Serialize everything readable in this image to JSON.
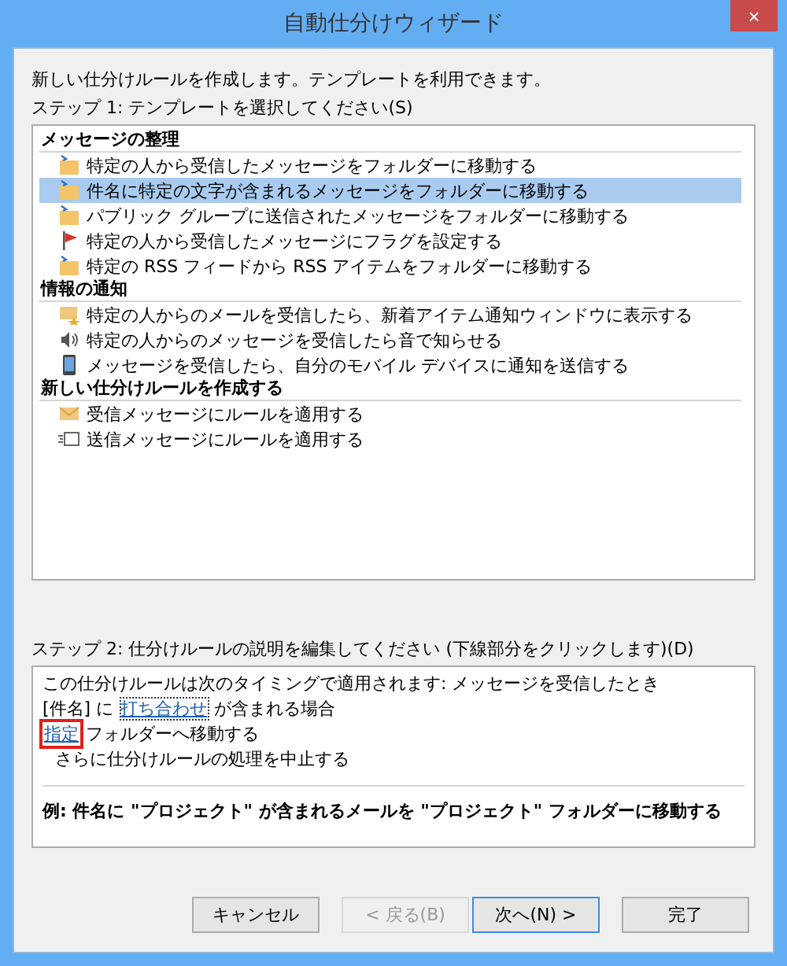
{
  "window": {
    "title": "自動仕分けウィザード",
    "close": "×"
  },
  "intro": "新しい仕分けルールを作成します。テンプレートを利用できます。",
  "step1_label": "ステップ 1: テンプレートを選択してください(S)",
  "groups": [
    {
      "title": "メッセージの整理",
      "items": [
        {
          "kind": "folder",
          "label": "特定の人から受信したメッセージをフォルダーに移動する",
          "selected": false
        },
        {
          "kind": "folder",
          "label": "件名に特定の文字が含まれるメッセージをフォルダーに移動する",
          "selected": true
        },
        {
          "kind": "folder",
          "label": "パブリック グループに送信されたメッセージをフォルダーに移動する",
          "selected": false
        },
        {
          "kind": "flag",
          "label": "特定の人から受信したメッセージにフラグを設定する",
          "selected": false
        },
        {
          "kind": "folder",
          "label": "特定の RSS フィードから RSS アイテムをフォルダーに移動する",
          "selected": false
        }
      ]
    },
    {
      "title": "情報の通知",
      "items": [
        {
          "kind": "mailstar",
          "label": "特定の人からのメールを受信したら、新着アイテム通知ウィンドウに表示する",
          "selected": false
        },
        {
          "kind": "speaker",
          "label": "特定の人からのメッセージを受信したら音で知らせる",
          "selected": false
        },
        {
          "kind": "phone",
          "label": "メッセージを受信したら、自分のモバイル デバイスに通知を送信する",
          "selected": false
        }
      ]
    },
    {
      "title": "新しい仕分けルールを作成する",
      "items": [
        {
          "kind": "mail",
          "label": "受信メッセージにルールを適用する",
          "selected": false
        },
        {
          "kind": "send",
          "label": "送信メッセージにルールを適用する",
          "selected": false
        }
      ]
    }
  ],
  "step2_label": "ステップ 2: 仕分けルールの説明を編集してください (下線部分をクリックします)(D)",
  "description_lines": [
    {
      "indent": false,
      "parts": [
        {
          "kind": "text",
          "text": "この仕分けルールは次のタイミングで適用されます: メッセージを受信したとき"
        }
      ]
    },
    {
      "indent": false,
      "parts": [
        {
          "kind": "text",
          "text": "[件名] に "
        },
        {
          "kind": "link",
          "text": "打ち合わせ",
          "focused": true,
          "highlighted": false
        },
        {
          "kind": "text",
          "text": " が含まれる場合"
        }
      ]
    },
    {
      "indent": false,
      "parts": [
        {
          "kind": "link",
          "text": "指定",
          "focused": false,
          "highlighted": true
        },
        {
          "kind": "text",
          "text": " フォルダーへ移動する"
        }
      ]
    },
    {
      "indent": true,
      "parts": [
        {
          "kind": "text",
          "text": "さらに仕分けルールの処理を中止する"
        }
      ]
    }
  ],
  "example": "例: 件名に \"プロジェクト\" が含まれるメールを \"プロジェクト\" フォルダーに移動する",
  "buttons": [
    {
      "label": "キャンセル",
      "disabled": false,
      "default": false
    },
    {
      "label": "< 戻る(B)",
      "disabled": true,
      "default": false
    },
    {
      "label": "次へ(N) >",
      "disabled": false,
      "default": true
    },
    {
      "label": "完了",
      "disabled": false,
      "default": false
    }
  ]
}
